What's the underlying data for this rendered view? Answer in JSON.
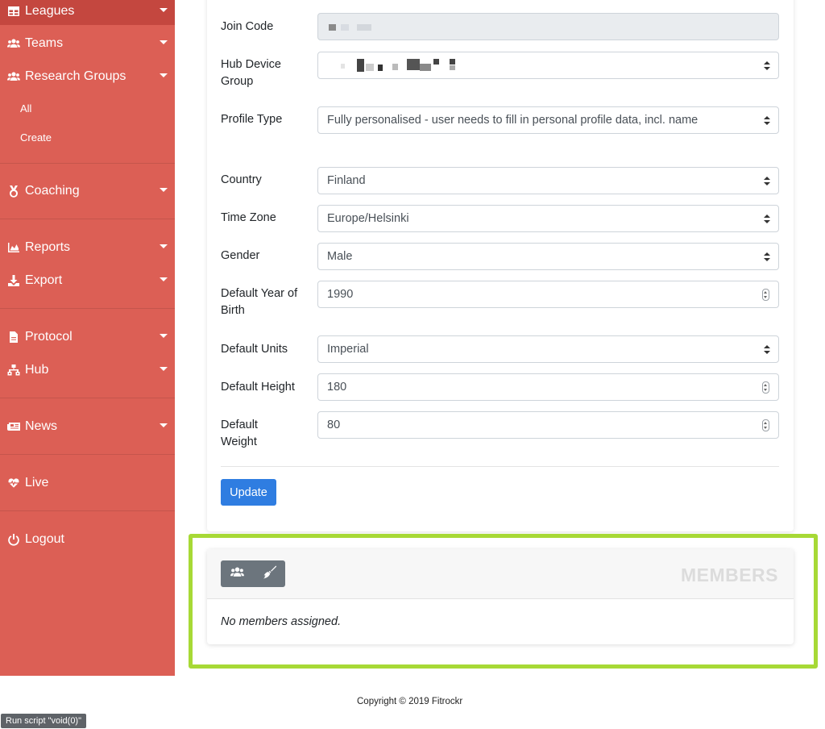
{
  "sidebar": {
    "items": [
      {
        "label": "Leagues",
        "icon": "table-icon"
      },
      {
        "label": "Teams",
        "icon": "users-icon"
      },
      {
        "label": "Research Groups",
        "icon": "users-icon"
      },
      {
        "label": "Coaching",
        "icon": "medal-icon"
      },
      {
        "label": "Reports",
        "icon": "chart-area-icon"
      },
      {
        "label": "Export",
        "icon": "download-icon"
      },
      {
        "label": "Protocol",
        "icon": "file-icon"
      },
      {
        "label": "Hub",
        "icon": "sitemap-icon"
      },
      {
        "label": "News",
        "icon": "newspaper-icon"
      },
      {
        "label": "Live",
        "icon": "heartbeat-icon"
      },
      {
        "label": "Logout",
        "icon": "power-icon"
      }
    ],
    "research_sub": {
      "all": "All",
      "create": "Create"
    }
  },
  "form": {
    "join_code_label": "Join Code",
    "hub_device_group_label": "Hub Device Group",
    "profile_type_label": "Profile Type",
    "profile_type_value": "Fully personalised - user needs to fill in personal profile data, incl. name",
    "country_label": "Country",
    "country_value": "Finland",
    "timezone_label": "Time Zone",
    "timezone_value": "Europe/Helsinki",
    "gender_label": "Gender",
    "gender_value": "Male",
    "birth_year_label": "Default Year of Birth",
    "birth_year_value": "1990",
    "units_label": "Default Units",
    "units_value": "Imperial",
    "height_label": "Default Height",
    "height_value": "180",
    "weight_label": "Default Weight",
    "weight_value": "80",
    "update_button": "Update"
  },
  "members": {
    "title": "MEMBERS",
    "empty_text": "No members assigned.",
    "buttons": [
      "users-icon",
      "broom-icon"
    ]
  },
  "highlight_color": "#a7d936",
  "sidebar_color": "#dc5f55",
  "footer": {
    "copyright": "Copyright © 2019 Fitrockr"
  },
  "status_bar": {
    "text": "Run script \"void(0)\""
  }
}
